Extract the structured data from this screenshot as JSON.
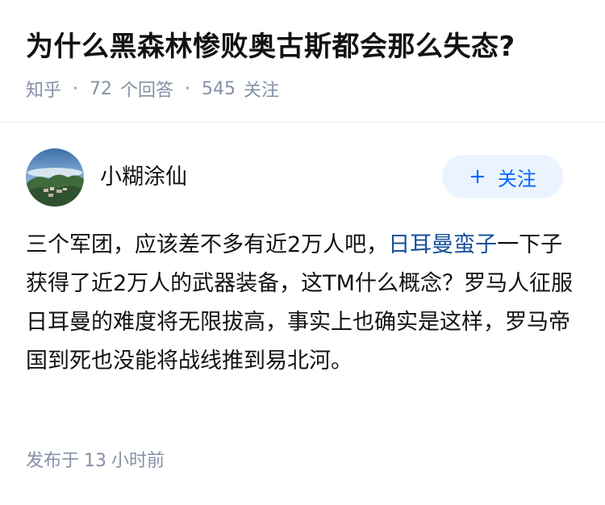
{
  "question": {
    "title": "为什么黑森林惨败奥古斯都会那么失态?",
    "source": "知乎",
    "answer_count": "72",
    "answer_suffix": "个回答",
    "follower_count": "545",
    "follower_suffix": "关注",
    "separator": "·"
  },
  "answer": {
    "author_name": "小糊涂仙",
    "follow_label": "关注",
    "follow_icon": "plus-icon",
    "content_before_link": "三个军团，应该差不多有近2万人吧，",
    "content_link": "日耳曼蛮子",
    "content_after_link": "一下子获得了近2万人的武器装备，这TM什么概念？罗马人征服日耳曼的难度将无限拔高，事实上也确实是这样，罗马帝国到死也没能将战线推到易北河。",
    "publish_prefix": "发布于",
    "publish_num": "13",
    "publish_suffix": "小时前"
  },
  "colors": {
    "title": "#121212",
    "meta": "#8590a6",
    "link": "#175199",
    "follow_bg": "#ebf4fe",
    "follow_text": "#0066ff"
  }
}
